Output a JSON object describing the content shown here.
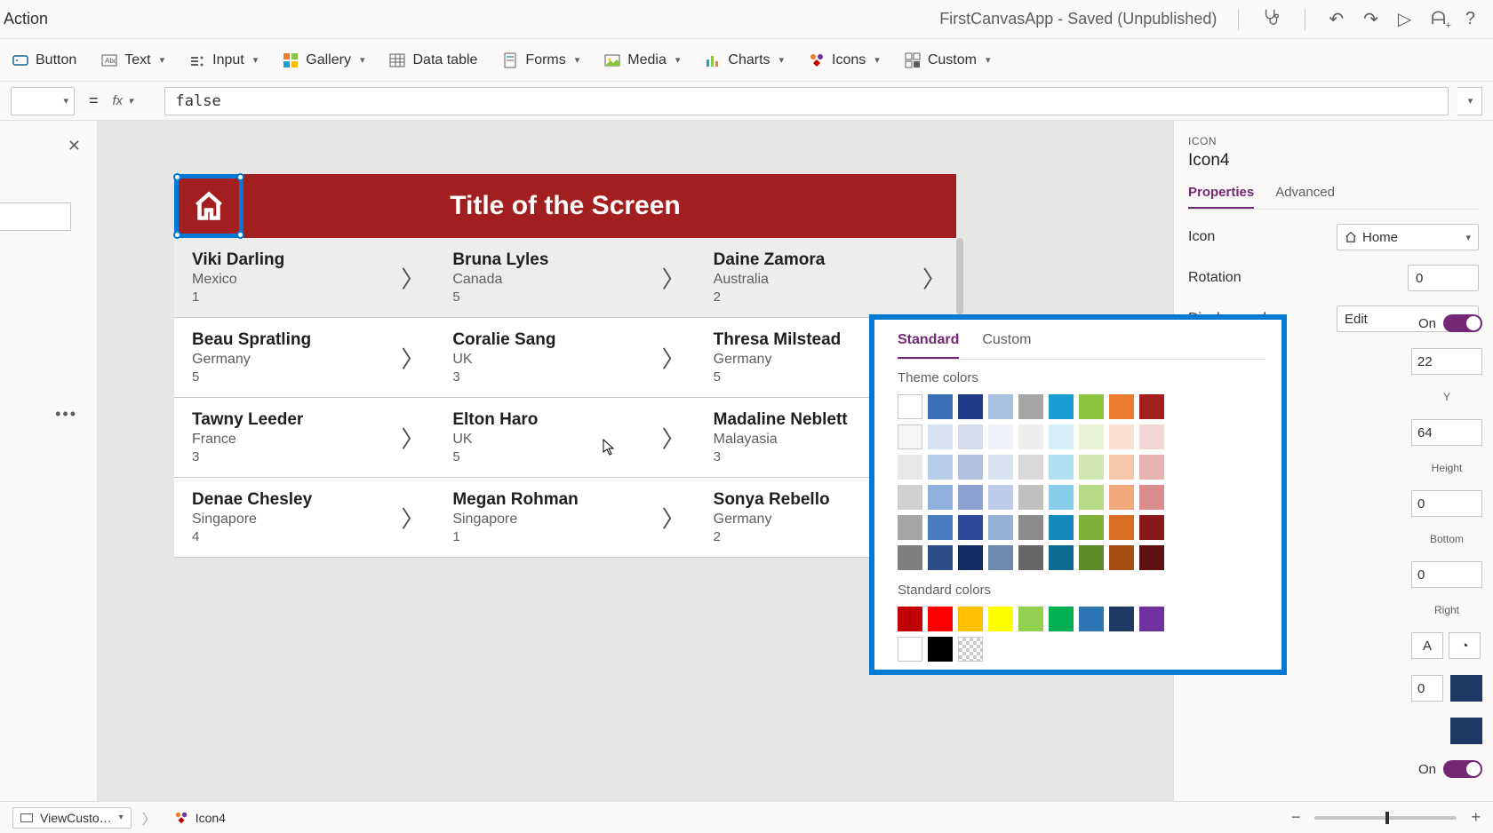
{
  "titlebar": {
    "action_label": "Action",
    "doc_title": "FirstCanvasApp - Saved (Unpublished)"
  },
  "ribbon": {
    "button": "Button",
    "text": "Text",
    "input": "Input",
    "gallery": "Gallery",
    "datatable": "Data table",
    "forms": "Forms",
    "media": "Media",
    "charts": "Charts",
    "icons": "Icons",
    "custom": "Custom"
  },
  "formula": {
    "value": "false"
  },
  "canvas": {
    "screen_title": "Title of the Screen",
    "rows": [
      [
        {
          "name": "Viki  Darling",
          "sub": "Mexico",
          "num": "1"
        },
        {
          "name": "Bruna  Lyles",
          "sub": "Canada",
          "num": "5"
        },
        {
          "name": "Daine  Zamora",
          "sub": "Australia",
          "num": "2"
        }
      ],
      [
        {
          "name": "Beau  Spratling",
          "sub": "Germany",
          "num": "5"
        },
        {
          "name": "Coralie  Sang",
          "sub": "UK",
          "num": "3"
        },
        {
          "name": "Thresa  Milstead",
          "sub": "Germany",
          "num": "5"
        }
      ],
      [
        {
          "name": "Tawny  Leeder",
          "sub": "France",
          "num": "3"
        },
        {
          "name": "Elton  Haro",
          "sub": "UK",
          "num": "5"
        },
        {
          "name": "Madaline  Neblett",
          "sub": "Malayasia",
          "num": "3"
        }
      ],
      [
        {
          "name": "Denae  Chesley",
          "sub": "Singapore",
          "num": "4"
        },
        {
          "name": "Megan  Rohman",
          "sub": "Singapore",
          "num": "1"
        },
        {
          "name": "Sonya  Rebello",
          "sub": "Germany",
          "num": "2"
        }
      ]
    ]
  },
  "props": {
    "kind": "ICON",
    "name": "Icon4",
    "tab_properties": "Properties",
    "tab_advanced": "Advanced",
    "icon_label": "Icon",
    "icon_value": "Home",
    "rotation_label": "Rotation",
    "rotation_value": "0",
    "displaymode_label": "Display mode",
    "displaymode_value": "Edit",
    "toggle1_label": "On",
    "val_22": "22",
    "val_64": "64",
    "label_y": "Y",
    "label_height": "Height",
    "label_bottom": "Bottom",
    "label_right": "Right",
    "val_0a": "0",
    "val_0b": "0",
    "val_0c": "0",
    "font_A": "A",
    "toggle2_label": "On"
  },
  "colorpicker": {
    "tab_standard": "Standard",
    "tab_custom": "Custom",
    "theme_label": "Theme colors",
    "standard_label": "Standard colors",
    "theme_rows": [
      [
        "#ffffff",
        "#3b6fb6",
        "#1f3c88",
        "#a9c0de",
        "#a6a6a6",
        "#1b9ed1",
        "#8bc53f",
        "#ed7d31",
        "#a31f1f"
      ],
      [
        "#f5f5f5",
        "#d6e2f2",
        "#d4dcee",
        "#eef3fa",
        "#eeeeee",
        "#d5eef7",
        "#e7f2d6",
        "#fbe0d1",
        "#f2d5d5"
      ],
      [
        "#e7e7e7",
        "#b7cce8",
        "#b3c1e0",
        "#d9e4f3",
        "#d9d9d9",
        "#b0dff0",
        "#d1e7b2",
        "#f6c6a9",
        "#e7b2b2"
      ],
      [
        "#cfcfcf",
        "#8fb0da",
        "#8aa1d1",
        "#bccbe7",
        "#bfbfbf",
        "#86cde8",
        "#b7da85",
        "#f1a97b",
        "#da8b8b"
      ],
      [
        "#a6a6a6",
        "#4a7bbf",
        "#2e4a9a",
        "#97b1d6",
        "#8c8c8c",
        "#1588bb",
        "#7fb13a",
        "#d86f23",
        "#8a1a1a"
      ],
      [
        "#7f7f7f",
        "#2b4f84",
        "#142a63",
        "#6e88b0",
        "#666666",
        "#0f6b92",
        "#5f8a28",
        "#a54f12",
        "#5f1010"
      ]
    ],
    "standard_rows": [
      [
        "#c00000",
        "#ff0000",
        "#ffc000",
        "#ffff00",
        "#92d050",
        "#00b050",
        "#2e75b6",
        "#1f3864",
        "#7030a0"
      ],
      [
        "#ffffff",
        "#000000",
        "transparent"
      ]
    ]
  },
  "statusbar": {
    "view_label": "ViewCusto…",
    "breadcrumb": "Icon4"
  }
}
